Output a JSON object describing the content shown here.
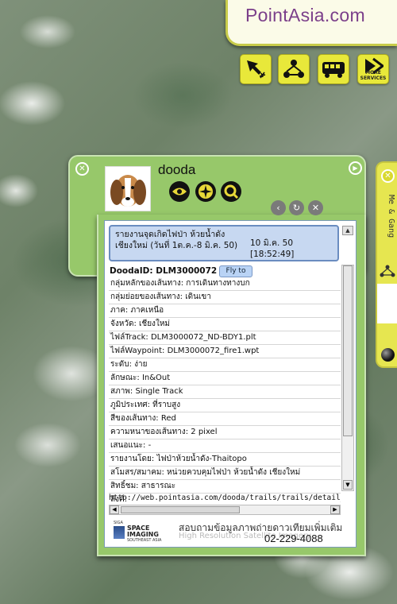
{
  "logo": {
    "text": "PointAsia.com"
  },
  "toolbar": {
    "more_services_label": "MORE SERVICES",
    "buttons": [
      "arrow-sparkle-icon",
      "people-network-icon",
      "bus-icon",
      "more-services-icon"
    ]
  },
  "side_tab": {
    "label": "Me & Gang"
  },
  "profile": {
    "username": "dooda",
    "action_icons": [
      "eye-icon",
      "compass-icon",
      "search-icon"
    ]
  },
  "report": {
    "title": "รายงานจุดเกิดไฟป่า ห้วยน้ำดัง เชียงใหม่ (วันที่ 1ต.ค.-8 มิ.ค. 50)",
    "datetime": "10 มิ.ค. 50 [18:52:49]",
    "dooda_id": "DoodaID: DLM3000072",
    "fly_to_label": "Fly to",
    "rows": [
      "กลุ่มหลักของเส้นทาง: การเดินทางทางบก",
      "กลุ่มย่อยของเส้นทาง: เดินเขา",
      "ภาค: ภาคเหนือ",
      "จังหวัด: เชียงใหม่",
      "ไฟล์Track: DLM3000072_ND-BDY1.plt",
      "ไฟล์Waypoint: DLM3000072_fire1.wpt",
      "ระดับ: ง่าย",
      "ลักษณะ: In&Out",
      "สภาพ: Single Track",
      "ภูมิประเทศ: ที่ราบสูง",
      "สีของเส้นทาง: Red",
      "ความหนาของเส้นทาง: 2 pixel",
      "เสนอแนะ: -",
      "รายงานโดย: ไฟป่าห้วยน้ำดัง-Thaitopo",
      "สโมสร/สมาคม: หน่วยควบคุมไฟป่า ห้วยน้ำดัง เชียงใหม่",
      "สิทธิ์ชม: สาธารณะ",
      "ลิงค์:"
    ],
    "link_url": "http://web.pointasia.com/dooda/trails/trails/detail_trail.asp?"
  },
  "ad": {
    "brand_top": "SIGA",
    "brand_name_1": "SPACE",
    "brand_name_2": "IMAGING",
    "brand_region": "SOUTHEAST ASIA",
    "thai_text": "สอบถามข้อมูลภาพถ่ายดาวเทียมเพิ่มเติม",
    "ghost_text": "High Resolution Satellite Imagery",
    "phone": "02-229-4088"
  }
}
